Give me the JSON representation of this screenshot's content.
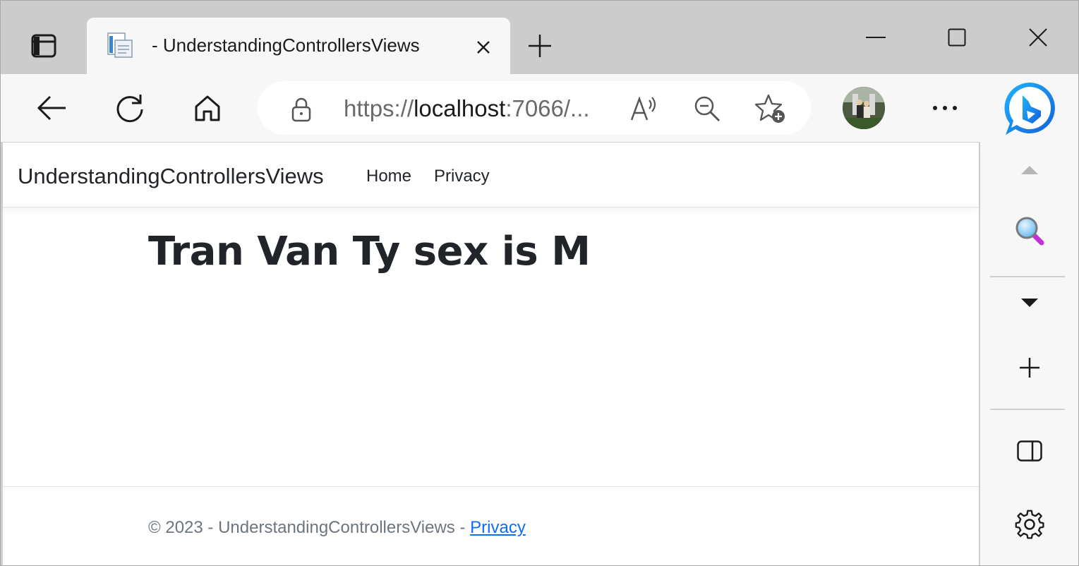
{
  "tab": {
    "title": "- UnderstandingControllersViews"
  },
  "addressbar": {
    "url_scheme": "https://",
    "url_host": "localhost",
    "url_rest": ":7066/..."
  },
  "page": {
    "brand": "UnderstandingControllersViews",
    "nav": [
      "Home",
      "Privacy"
    ],
    "heading": "Tran Van Ty sex is M",
    "footer_text": "© 2023 - UnderstandingControllersViews - ",
    "footer_link": "Privacy"
  },
  "icons": {
    "tab_actions": "tab-actions-icon",
    "favicon": "document-favicon-icon",
    "close_tab": "close-icon",
    "new_tab": "plus-icon",
    "minimize": "minimize-icon",
    "maximize": "maximize-icon",
    "close_window": "close-icon",
    "back": "back-arrow-icon",
    "refresh": "refresh-icon",
    "home": "home-icon",
    "lock": "lock-icon",
    "read_aloud": "read-aloud-icon",
    "zoom_out": "zoom-out-icon",
    "favorites": "add-favorite-icon",
    "more": "more-icon",
    "copilot": "bing-copilot-icon",
    "sidebar_search": "search-icon",
    "sidebar_add": "plus-icon",
    "sidebar_split": "split-screen-icon",
    "sidebar_settings": "gear-icon"
  },
  "colors": {
    "link": "#0d6efd",
    "text": "#212529",
    "muted": "#6c757d",
    "chrome": "#cccccc",
    "toolbar": "#f7f7f7"
  }
}
